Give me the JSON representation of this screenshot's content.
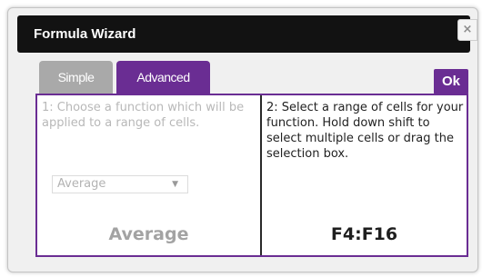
{
  "dialog": {
    "title": "Formula Wizard",
    "close_icon": "close-icon",
    "close_glyph": "×"
  },
  "tabs": [
    {
      "label": "Simple",
      "active": false
    },
    {
      "label": "Advanced",
      "active": true
    }
  ],
  "ok_label": "Ok",
  "step1": {
    "text": "1: Choose a function which will be applied to a range of cells.",
    "select": {
      "selected": "Average",
      "arrow_icon": "chevron-down-icon",
      "arrow_glyph": "▼"
    },
    "result": "Average"
  },
  "step2": {
    "text": "2: Select a range of cells for your function. Hold down shift to select multiple cells or drag the selection box.",
    "result": "F4:F16"
  },
  "colors": {
    "accent": "#6a2d93",
    "titlebar": "#121212",
    "inactive_tab": "#a9a9a9"
  }
}
